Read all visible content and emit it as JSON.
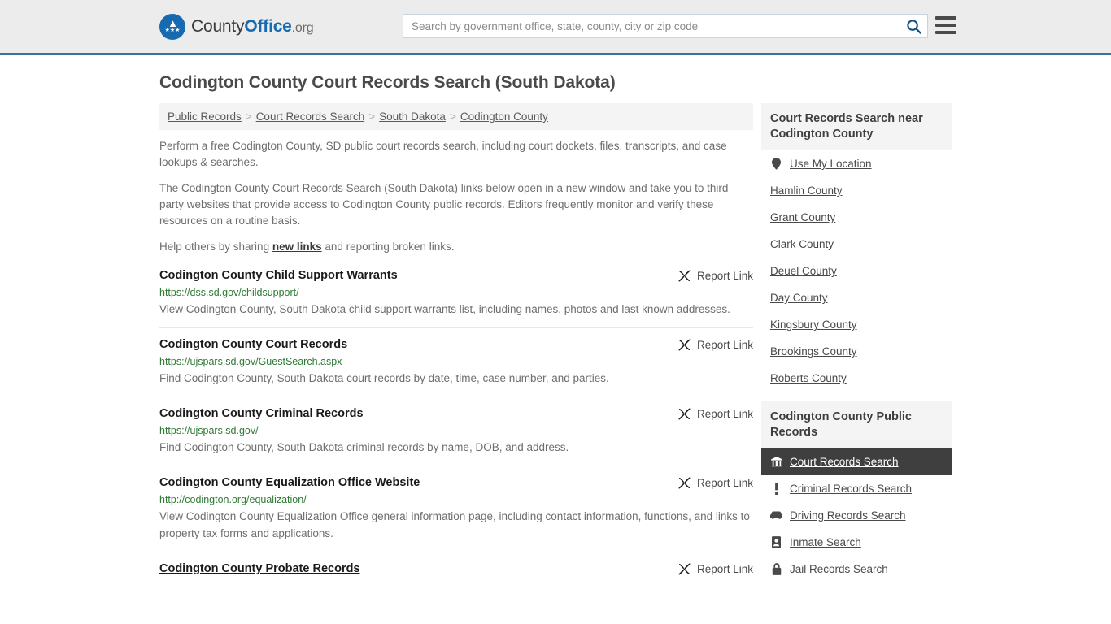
{
  "header": {
    "brand_name_1": "County",
    "brand_name_2": "Office",
    "brand_tld": ".org",
    "brand_mark_icon": "eagle-seal-icon",
    "search_placeholder": "Search by government office, state, county, city or zip code",
    "search_value": "",
    "search_icon": "search-icon",
    "menu_icon": "hamburger-menu-icon",
    "accent_color": "#3b6f9e",
    "brand_blue": "#1769b0"
  },
  "page_title": "Codington County Court Records Search (South Dakota)",
  "breadcrumb": {
    "separator": ">",
    "items": [
      {
        "label": "Public Records"
      },
      {
        "label": "Court Records Search"
      },
      {
        "label": "South Dakota"
      },
      {
        "label": "Codington County"
      }
    ]
  },
  "intro": {
    "p1": "Perform a free Codington County, SD public court records search, including court dockets, files, transcripts, and case lookups & searches.",
    "p2": "The Codington County Court Records Search (South Dakota) links below open in a new window and take you to third party websites that provide access to Codington County public records. Editors frequently monitor and verify these resources on a routine basis.",
    "p3_before": "Help others by sharing ",
    "p3_link": "new links",
    "p3_after": " and reporting broken links."
  },
  "report_link_label": "Report Link",
  "report_link_icon": "broken-link-icon",
  "results": [
    {
      "title": "Codington County Child Support Warrants",
      "url": "https://dss.sd.gov/childsupport/",
      "desc": "View Codington County, South Dakota child support warrants list, including names, photos and last known addresses."
    },
    {
      "title": "Codington County Court Records",
      "url": "https://ujspars.sd.gov/GuestSearch.aspx",
      "desc": "Find Codington County, South Dakota court records by date, time, case number, and parties."
    },
    {
      "title": "Codington County Criminal Records",
      "url": "https://ujspars.sd.gov/",
      "desc": "Find Codington County, South Dakota criminal records by name, DOB, and address."
    },
    {
      "title": "Codington County Equalization Office Website",
      "url": "http://codington.org/equalization/",
      "desc": "View Codington County Equalization Office general information page, including contact information, functions, and links to property tax forms and applications."
    },
    {
      "title": "Codington County Probate Records",
      "url": "",
      "desc": ""
    }
  ],
  "sidebar": {
    "nearby": {
      "heading": "Court Records Search near Codington County",
      "items": [
        {
          "label": "Use My Location",
          "icon": "map-pin-icon"
        },
        {
          "label": "Hamlin County",
          "icon": ""
        },
        {
          "label": "Grant County",
          "icon": ""
        },
        {
          "label": "Clark County",
          "icon": ""
        },
        {
          "label": "Deuel County",
          "icon": ""
        },
        {
          "label": "Day County",
          "icon": ""
        },
        {
          "label": "Kingsbury County",
          "icon": ""
        },
        {
          "label": "Brookings County",
          "icon": ""
        },
        {
          "label": "Roberts County",
          "icon": ""
        }
      ]
    },
    "public_records": {
      "heading": "Codington County Public Records",
      "active_index": 0,
      "items": [
        {
          "label": "Court Records Search",
          "icon": "courthouse-icon",
          "active": true
        },
        {
          "label": "Criminal Records Search",
          "icon": "exclamation-icon",
          "active": false
        },
        {
          "label": "Driving Records Search",
          "icon": "car-icon",
          "active": false
        },
        {
          "label": "Inmate Search",
          "icon": "id-badge-icon",
          "active": false
        },
        {
          "label": "Jail Records Search",
          "icon": "lock-icon",
          "active": false
        }
      ]
    }
  }
}
